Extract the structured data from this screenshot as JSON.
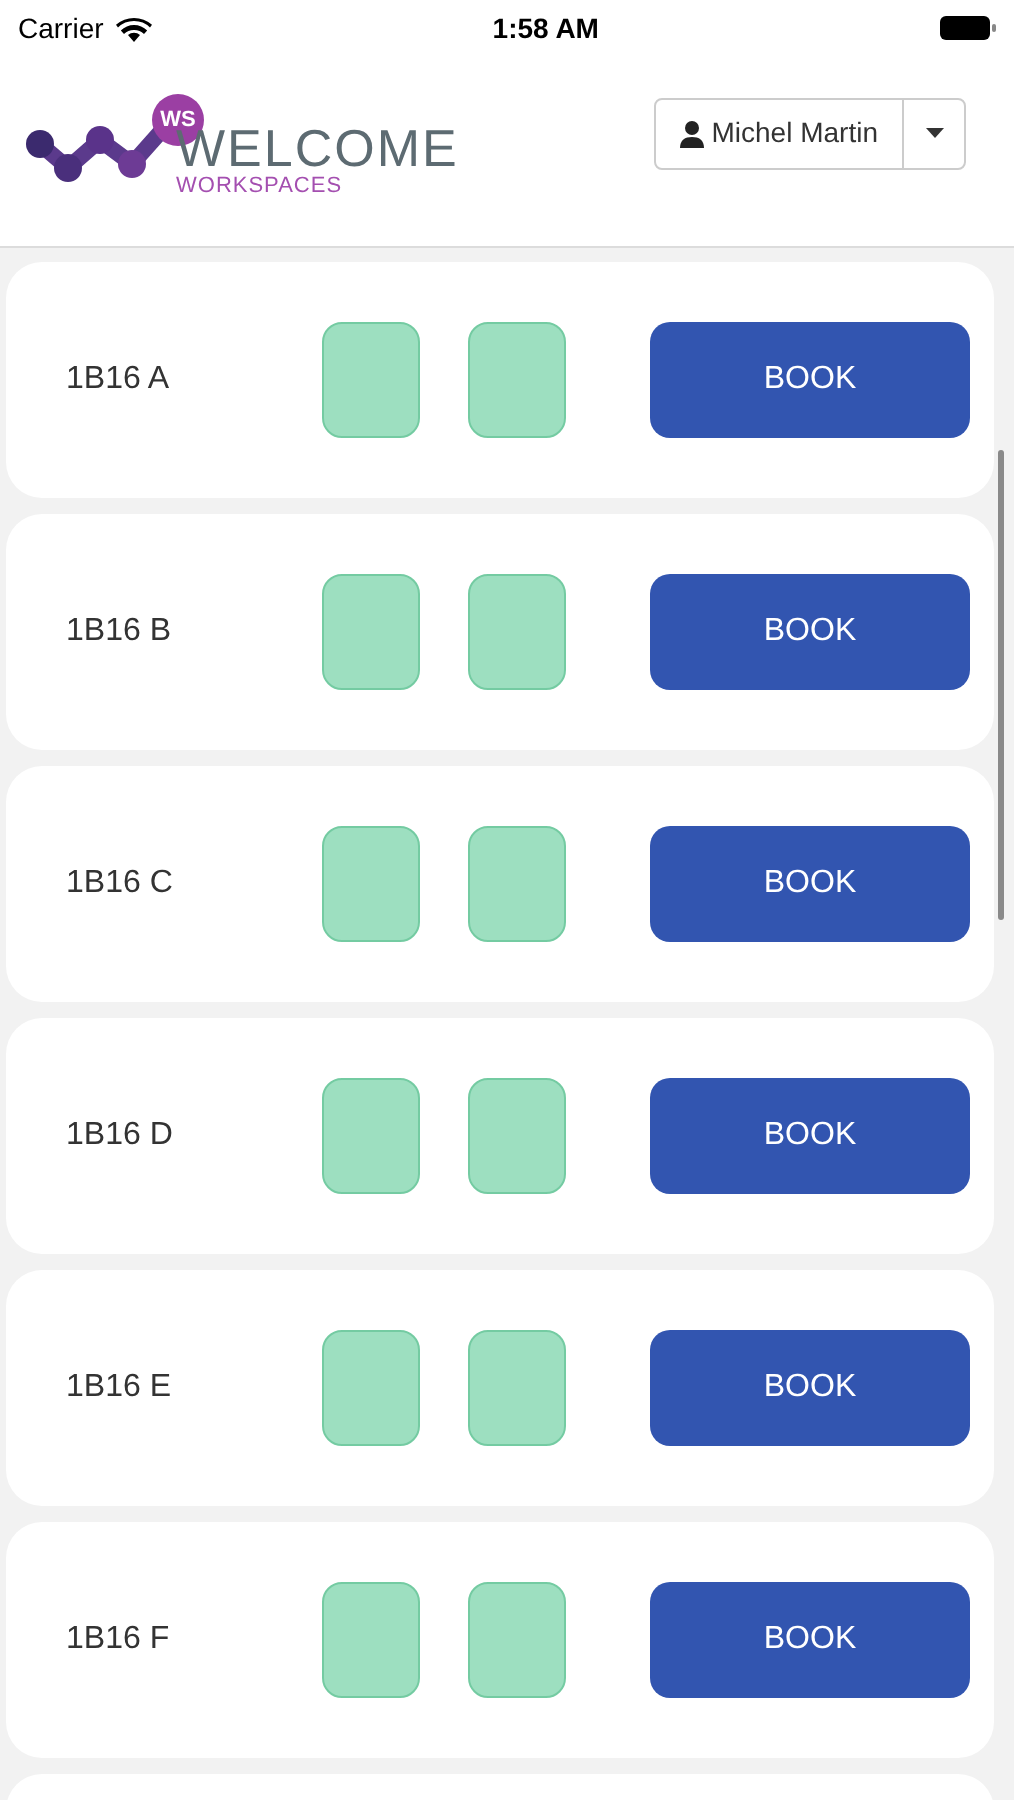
{
  "status_bar": {
    "carrier": "Carrier",
    "time": "1:58 AM"
  },
  "header": {
    "logo_badge": "WS",
    "logo_title": "WELCOME",
    "logo_subtitle": "WORKSPACES",
    "user_name": "Michel Martin"
  },
  "desks": [
    {
      "name": "1B16 A",
      "slots": [
        {
          "available": true
        },
        {
          "available": true
        }
      ],
      "button": "BOOK"
    },
    {
      "name": "1B16 B",
      "slots": [
        {
          "available": true
        },
        {
          "available": true
        }
      ],
      "button": "BOOK"
    },
    {
      "name": "1B16 C",
      "slots": [
        {
          "available": true
        },
        {
          "available": true
        }
      ],
      "button": "BOOK"
    },
    {
      "name": "1B16 D",
      "slots": [
        {
          "available": true
        },
        {
          "available": true
        }
      ],
      "button": "BOOK"
    },
    {
      "name": "1B16 E",
      "slots": [
        {
          "available": true
        },
        {
          "available": true
        }
      ],
      "button": "BOOK"
    },
    {
      "name": "1B16 F",
      "slots": [
        {
          "available": true
        },
        {
          "available": true
        }
      ],
      "button": "BOOK"
    }
  ]
}
